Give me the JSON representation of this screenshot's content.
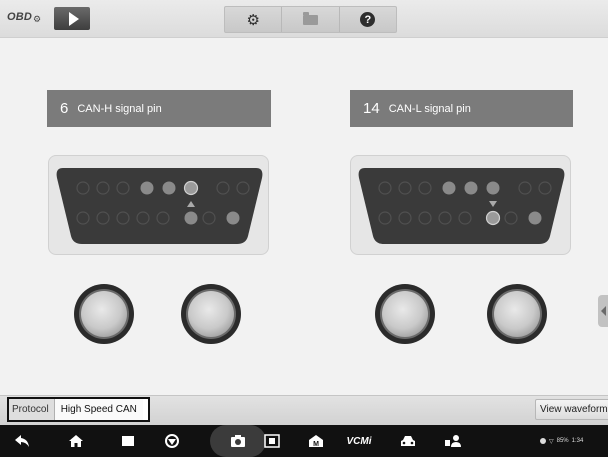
{
  "app": {
    "logo_text": "OBD",
    "toolbar_icons": [
      "play-icon",
      "gear-icon",
      "folder-icon",
      "help-icon"
    ],
    "help_glyph": "?"
  },
  "pins": {
    "left": {
      "number": "6",
      "label": "CAN-H signal pin"
    },
    "right": {
      "number": "14",
      "label": "CAN-L signal pin"
    }
  },
  "status_bar": {
    "protocol_label": "Protocol",
    "protocol_value": "High Speed CAN",
    "view_waveform_label": "View waveform"
  },
  "nav_bar": {
    "icons": [
      "back-icon",
      "home-icon",
      "recent-apps-icon",
      "browser-icon",
      "camera-icon",
      "screen-capture-icon",
      "m-icon",
      "vcmi-icon",
      "car-icon",
      "remote-icon"
    ],
    "vcmi_label": "VCMi",
    "m_label": "M",
    "battery": "85%",
    "time": "1:34"
  },
  "colors": {
    "pin_label_bg": "#7b7b7b",
    "connector_body": "#3a3a3a",
    "nav_bg": "#111111"
  }
}
